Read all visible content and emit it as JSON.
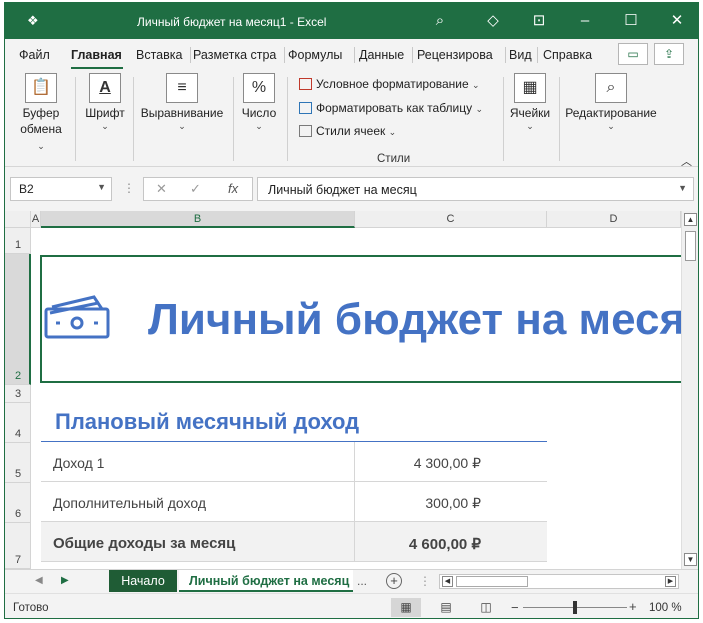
{
  "titlebar": {
    "app_icon": "excel-autosave-icon",
    "title": "Личный бюджет на месяц1  -  Excel"
  },
  "tabs": [
    "Файл",
    "Главная",
    "Вставка",
    "Разметка стра",
    "Формулы",
    "Данные",
    "Рецензирова",
    "Вид",
    "Справка"
  ],
  "ribbon": {
    "clipboard": {
      "label1": "Буфер",
      "label2": "обмена"
    },
    "font": {
      "label": "Шрифт"
    },
    "alignment": {
      "label": "Выравнивание"
    },
    "number": {
      "label": "Число"
    },
    "styles": {
      "conditional": "Условное форматирование",
      "as_table": "Форматировать как таблицу",
      "cell_styles": "Стили ячеек",
      "group_label": "Стили"
    },
    "cells": {
      "label": "Ячейки"
    },
    "editing": {
      "label": "Редактирование"
    }
  },
  "formula_bar": {
    "name_box": "B2",
    "fx": "fx",
    "value": "Личный бюджет на месяц"
  },
  "columns": [
    "A",
    "B",
    "C",
    "D"
  ],
  "rows": [
    "1",
    "2",
    "3",
    "4",
    "5",
    "6",
    "7"
  ],
  "sheet": {
    "title": "Личный бюджет на месяц",
    "income_heading": "Плановый месячный доход",
    "income_rows": [
      {
        "label": "Доход 1",
        "value": "4 300,00 ₽"
      },
      {
        "label": "Дополнительный доход",
        "value": "300,00 ₽"
      },
      {
        "label": "Общие доходы за месяц",
        "value": "4 600,00 ₽"
      }
    ]
  },
  "sheet_tabs": [
    "Начало",
    "Личный бюджет на месяц"
  ],
  "status": {
    "text": "Готово",
    "zoom": "100 %",
    "zoom_level": 1.0
  },
  "colors": {
    "excel_green": "#1f6e43",
    "accent_blue": "#4472c4",
    "start_tab": "#1f5c35"
  }
}
